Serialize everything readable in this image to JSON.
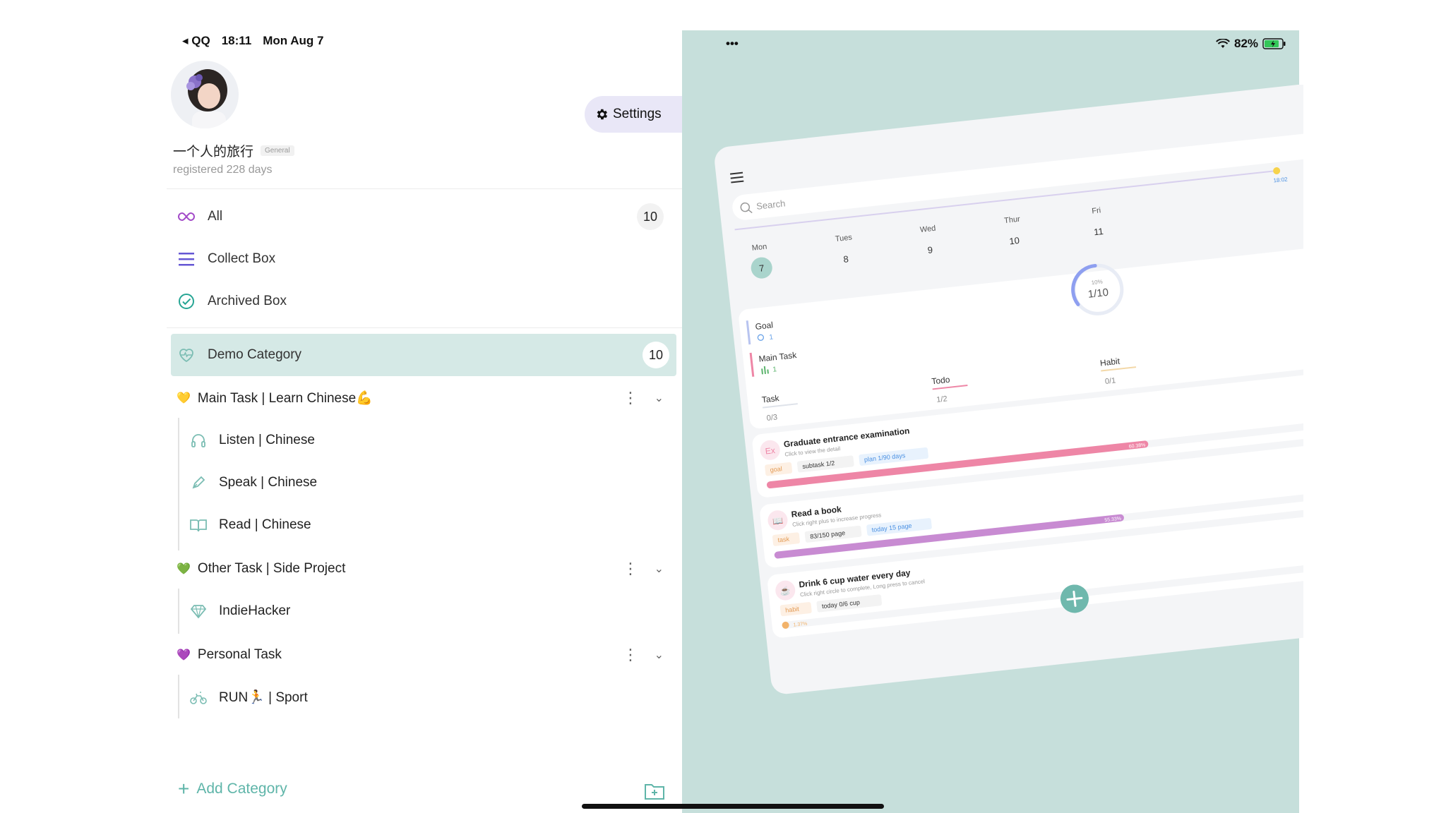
{
  "status_bar": {
    "back_app": "◂ QQ",
    "time": "18:11",
    "date": "Mon Aug 7",
    "dots": "•••",
    "battery": "82%"
  },
  "profile": {
    "name": "一个人的旅行",
    "tag": "General",
    "registered": "registered 228 days",
    "settings_label": "Settings"
  },
  "nav": {
    "all": {
      "label": "All",
      "count": "10"
    },
    "collect": {
      "label": "Collect Box"
    },
    "archived": {
      "label": "Archived Box"
    },
    "demo": {
      "label": "Demo Category",
      "count": "10"
    }
  },
  "groups": [
    {
      "heart": "💛",
      "label": "Main Task | Learn Chinese💪",
      "items": [
        "Listen | Chinese",
        "Speak | Chinese",
        "Read | Chinese"
      ]
    },
    {
      "heart": "💚",
      "label": "Other Task | Side Project",
      "items": [
        "IndieHacker"
      ]
    },
    {
      "heart": "💜",
      "label": "Personal Task",
      "items": [
        "RUN🏃 | Sport"
      ]
    }
  ],
  "add_category": "Add Category",
  "preview": {
    "search_placeholder": "Search",
    "time_marker": "18:02",
    "days": [
      {
        "name": "Mon",
        "num": "7"
      },
      {
        "name": "Tues",
        "num": "8"
      },
      {
        "name": "Wed",
        "num": "9"
      },
      {
        "name": "Thur",
        "num": "10"
      },
      {
        "name": "Fri",
        "num": "11"
      }
    ],
    "goal_label": "Goal",
    "goal_count": "1",
    "main_task_label": "Main Task",
    "main_task_count": "1",
    "ring_percent": "10%",
    "ring_value": "1/10",
    "task_label": "Task",
    "task_value": "0/3",
    "todo_label": "Todo",
    "todo_value": "1/2",
    "habit_label": "Habit",
    "habit_value": "0/1",
    "cards": [
      {
        "icon": "Ex",
        "title": "Graduate entrance examination",
        "sub": "Click to view the detail",
        "tags": [
          "goal",
          "subtask 1/2",
          "plan 1/90 days"
        ],
        "percent": "60.38%",
        "progress": 0.6038,
        "color": "#ee86a6"
      },
      {
        "icon": "📖",
        "title": "Read a book",
        "sub": "Click right plus to increase progress",
        "tags": [
          "task",
          "83/150 page",
          "today 15 page"
        ],
        "percent": "55.33%",
        "progress": 0.5533,
        "color": "#c88bd2"
      },
      {
        "icon": "☕",
        "title": "Drink 6 cup water every day",
        "sub": "Click right circle to complete, Long press to cancel",
        "tags": [
          "habit",
          "today 0/6 cup"
        ],
        "percent": "1.37%",
        "progress": 0.0137,
        "color": "#f2b36a"
      }
    ]
  },
  "colors": {
    "accent": "#5fb5a9",
    "demo_bg": "#d5e9e6",
    "right_bg": "#c6dfdb",
    "settings_bg": "#e9e7f7"
  }
}
